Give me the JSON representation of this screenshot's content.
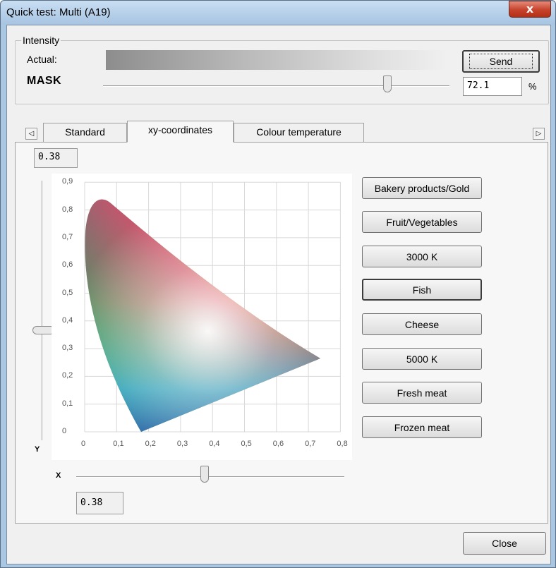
{
  "window": {
    "title": "Quick test: Multi (A19)",
    "close_glyph": "x"
  },
  "intensity": {
    "group_label": "Intensity",
    "actual_label": "Actual:",
    "mask_label": "MASK",
    "send_label": "Send",
    "value": "72.1",
    "unit": "%",
    "level_fraction": 0.721
  },
  "tabs": [
    {
      "label": "Standard",
      "active": false
    },
    {
      "label": "xy-coordinates",
      "active": true
    },
    {
      "label": "Colour temperature",
      "active": false
    }
  ],
  "tab_scroll": {
    "left_glyph": "◁",
    "right_glyph": "▷"
  },
  "xy": {
    "y_value": "0.38",
    "x_value": "0.38",
    "y_axis_label": "Y",
    "x_axis_label": "X",
    "x_ticks": [
      "0",
      "0,1",
      "0,2",
      "0,3",
      "0,4",
      "0,5",
      "0,6",
      "0,7",
      "0,8"
    ],
    "y_ticks": [
      "0",
      "0,1",
      "0,2",
      "0,3",
      "0,4",
      "0,5",
      "0,6",
      "0,7",
      "0,8",
      "0,9"
    ]
  },
  "presets": [
    "Bakery products/Gold",
    "Fruit/Vegetables",
    "3000 K",
    "Fish",
    "Cheese",
    "5000 K",
    "Fresh meat",
    "Frozen meat"
  ],
  "close_label": "Close"
}
